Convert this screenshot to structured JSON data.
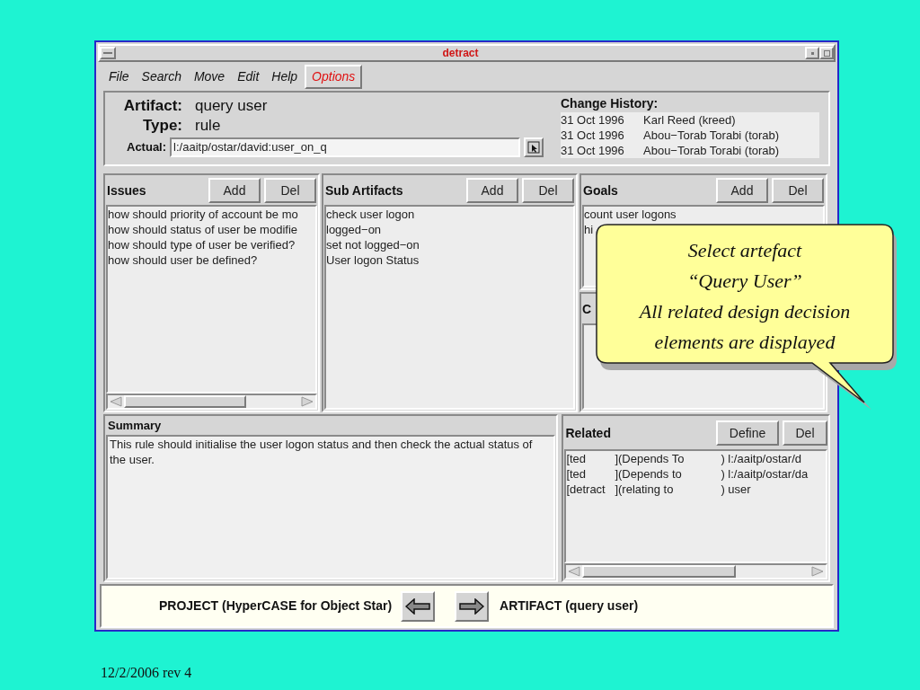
{
  "window": {
    "title": "detract"
  },
  "menu": [
    {
      "label": "File",
      "kind": "item"
    },
    {
      "label": "Search",
      "kind": "item"
    },
    {
      "label": "Move",
      "kind": "item"
    },
    {
      "label": "Edit",
      "kind": "item"
    },
    {
      "label": "Help",
      "kind": "item"
    },
    {
      "label": "Options",
      "kind": "button"
    }
  ],
  "artifact": {
    "artifact_label": "Artifact:",
    "artifact_value": "query user",
    "type_label": "Type:",
    "type_value": "rule",
    "actual_label": "Actual:",
    "actual_value": "l:/aaitp/ostar/david:user_on_q"
  },
  "change_history": {
    "title": "Change History:",
    "entries": [
      {
        "date": "31 Oct 1996",
        "author": "Karl Reed (kreed)"
      },
      {
        "date": "31 Oct 1996",
        "author": "Abou−Torab Torabi (torab)"
      },
      {
        "date": "31 Oct 1996",
        "author": "Abou−Torab Torabi (torab)"
      }
    ]
  },
  "issues": {
    "title": "Issues",
    "buttons": [
      "Add",
      "Del"
    ],
    "items": [
      "how should priority of account be mo",
      "how should status of user be modifie",
      "how should type of user be verified?",
      "how should user be defined?"
    ]
  },
  "sub_artifacts": {
    "title": "Sub Artifacts",
    "buttons": [
      "Add",
      "Del"
    ],
    "items": [
      "check user logon",
      "logged−on",
      "set not logged−on",
      "User logon Status"
    ]
  },
  "goals": {
    "title": "Goals",
    "buttons": [
      "Add",
      "Del"
    ],
    "items": [
      "count user logons",
      "hi"
    ]
  },
  "panel_5": {
    "title": "C"
  },
  "summary": {
    "title": "Summary",
    "text": "This rule should initialise the user logon status and then check the actual status of the user."
  },
  "related": {
    "title": "Related",
    "buttons": [
      "Define",
      "Del"
    ],
    "rows": [
      {
        "column_1": "[ted",
        "column_2": "](Depends To",
        "column_3": ") l:/aaitp/ostar/d"
      },
      {
        "column_1": "[ted",
        "column_2": "](Depends to",
        "column_3": ") l:/aaitp/ostar/da"
      },
      {
        "column_1": "[detract",
        "column_2": "](relating to",
        "column_3": ") user"
      }
    ]
  },
  "navigation": {
    "back_label": "PROJECT (HyperCASE for Object Star)",
    "forward_label": "ARTIFACT (query user)"
  },
  "callout": {
    "lines": [
      "Select artefact",
      "“Query User”",
      "All related design decision",
      "elements are displayed"
    ]
  },
  "footer": {
    "text": "12/2/2006 rev 4"
  }
}
